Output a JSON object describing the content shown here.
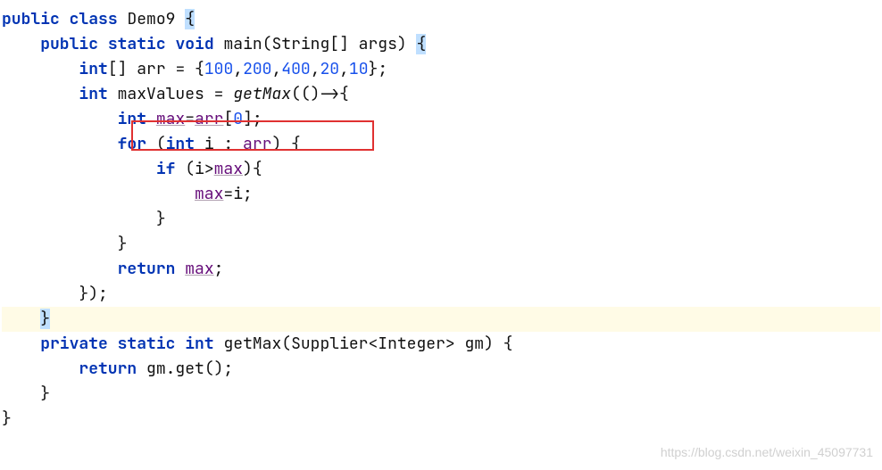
{
  "code": {
    "l1_public": "public",
    "l1_class": "class",
    "l1_name": "Demo9",
    "l1_ob": "{",
    "l2_public": "public",
    "l2_static": "static",
    "l2_void": "void",
    "l2_main": "main",
    "l2_sig": "(String[] args) ",
    "l2_ob": "{",
    "l3_int": "int",
    "l3_brk": "[]",
    "l3_arr": "arr",
    "l3_eq": " = {",
    "l3_n1": "100",
    "l3_c1": ",",
    "l3_n2": "200",
    "l3_c2": ",",
    "l3_n3": "400",
    "l3_c3": ",",
    "l3_n4": "20",
    "l3_c4": ",",
    "l3_n5": "10",
    "l3_end": "};",
    "l4_int": "int",
    "l4_mv": "maxValues",
    "l4_eq": " = ",
    "l4_fn": "getMax",
    "l4_args": "(()->{",
    "l5_int": "int",
    "l5_sp": " ",
    "l5_max": "max",
    "l5_eq": "=",
    "l5_arr": "arr",
    "l5_br": "[",
    "l5_0": "0",
    "l5_br2": "];",
    "l6_for": "for",
    "l6_o": " (",
    "l6_int": "int",
    "l6_i": " i : ",
    "l6_arr": "arr",
    "l6_c": ") {",
    "l7_if": "if",
    "l7_o": " (i>",
    "l7_max": "max",
    "l7_c": "){",
    "l8_max": "max",
    "l8_eq": "=i;",
    "l9_cb": "}",
    "l10_cb": "}",
    "l11_ret": "return",
    "l11_sp": " ",
    "l11_max": "max",
    "l11_sc": ";",
    "l12": "});",
    "l13": "}",
    "l14_priv": "private",
    "l14_static": "static",
    "l14_int": "int",
    "l14_gm": "getMax",
    "l14_sig": "(Supplier<Integer> gm) {",
    "l15_ret": "return",
    "l15_body": " gm.get();",
    "l16": "}",
    "l17": "}"
  },
  "watermark": "https://blog.csdn.net/weixin_45097731"
}
